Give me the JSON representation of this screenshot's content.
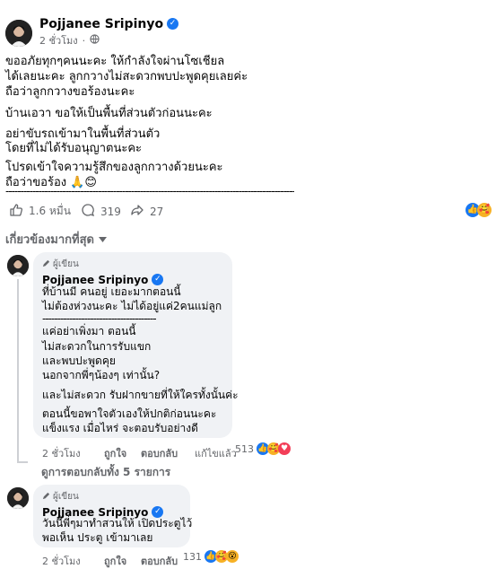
{
  "post": {
    "author": "Pojjanee Sripinyo",
    "time": "2 ชั่วโมง",
    "lines": [
      "ขออภัยทุกๆคนนะคะ ให้กำลังใจผ่านโซเชียล",
      "ได้เลยนะคะ ลูกกวางไม่สะดวกพบปะพูดคุยเลยค่ะ",
      "ถือว่าลูกกวางขอร้องนะคะ",
      "บ้านเอวา ขอให้เป็นพื้นที่ส่วนตัวก่อนนะคะ",
      "อย่าขับรถเข้ามาในพื้นที่ส่วนตัว",
      "โดยที่ไม่ได้รับอนุญาตนะคะ",
      "โปรดเข้าใจความรู้สึกของลูกกวางด้วยนะคะ",
      "ถือว่าขอร้อง 🙏😊"
    ],
    "divider": "----------------------------------------------------------------------------------------------------",
    "likes": "1.6 หมื่น",
    "comments": "319",
    "shares": "27"
  },
  "filter": {
    "label": "เกี่ยวข้องมากที่สุด"
  },
  "comment1": {
    "badge": "ผู้เขียน",
    "author": "Pojjanee Sripinyo",
    "lines": [
      "ที่บ้านมี คนอยู่ เยอะมากตอนนี้",
      "ไม่ต้องห่วงนะคะ ไม่ได้อยู่แค่2คนแม่ลูก",
      "--------------------------------------",
      "แค่อย่าเพิ่งมา ตอนนี้",
      "ไม่สะดวกในการรับแขก",
      "และพบปะพูดคุย",
      "นอกจากพี่ๆน้องๆ เท่านั้น?",
      "และไม่สะดวก รับฝากขายที่ให้ใครทั้งนั้นค่ะ",
      "ตอนนี้ขอพาใจตัวเองให้ปกติก่อนนะคะ",
      "แข็งแรง เมื่อไหร่ จะตอบรับอย่างดี"
    ],
    "time": "2 ชั่วโมง",
    "like": "ถูกใจ",
    "reply": "ตอบกลับ",
    "edited": "แก้ไขแล้ว",
    "count": "513"
  },
  "replies_link": "ดูการตอบกลับทั้ง 5 รายการ",
  "comment2": {
    "badge": "ผู้เขียน",
    "author": "Pojjanee Sripinyo",
    "lines": [
      "วันนี้พี่ๆมาทำสวนให้ เปิดประตูไว้",
      "พอเห็น ประตู เข้ามาเลย"
    ],
    "time": "2 ชั่วโมง",
    "like": "ถูกใจ",
    "reply": "ตอบกลับ",
    "count": "131"
  },
  "colors": {
    "brand": "#1877f2",
    "muted": "#65676b",
    "bubble": "#f0f2f5"
  }
}
